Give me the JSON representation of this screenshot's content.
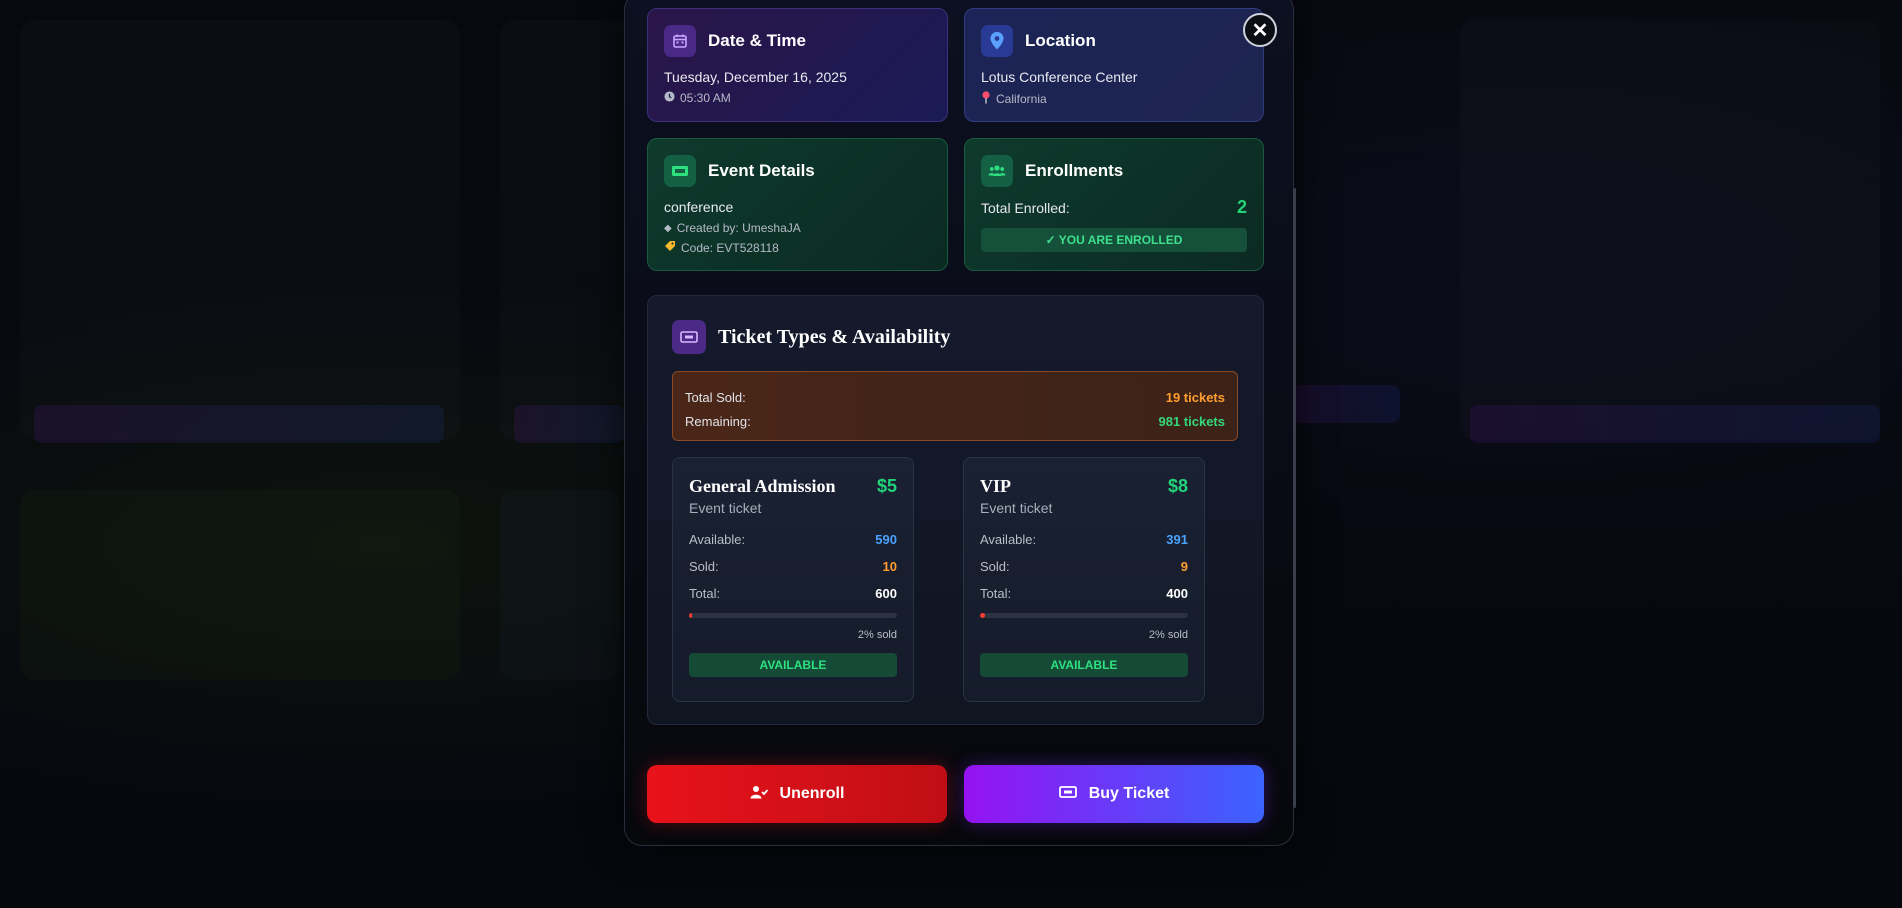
{
  "colors": {
    "accent_green": "#22d37a",
    "accent_orange": "#ff9d2e",
    "accent_blue": "#4aa3ff",
    "danger_red": "#e8121a",
    "purple": "#9512f2"
  },
  "modal": {
    "close_icon": "close-icon",
    "date_time": {
      "title": "Date & Time",
      "icon": "calendar-icon",
      "date": "Tuesday, December 16, 2025",
      "time": "05:30 AM"
    },
    "location": {
      "title": "Location",
      "icon": "map-pin-icon",
      "venue": "Lotus Conference Center",
      "region": "California"
    },
    "event_details": {
      "title": "Event Details",
      "icon": "ticket-icon",
      "category": "conference",
      "created_by": "Created by: UmeshaJA",
      "code": "Code: EVT528118"
    },
    "enrollments": {
      "title": "Enrollments",
      "icon": "users-icon",
      "label": "Total Enrolled:",
      "count": "2",
      "badge": "✓ YOU ARE ENROLLED"
    },
    "tickets": {
      "title": "Ticket Types & Availability",
      "summary": {
        "sold_label": "Total Sold:",
        "sold_value": "19 tickets",
        "remaining_label": "Remaining:",
        "remaining_value": "981 tickets"
      },
      "types": [
        {
          "name": "General Admission",
          "price": "$5",
          "description": "Event ticket",
          "available_label": "Available:",
          "available": "590",
          "sold_label": "Sold:",
          "sold": "10",
          "total_label": "Total:",
          "total": "600",
          "sold_fraction": 0.0167,
          "percent_text": "2% sold",
          "status": "AVAILABLE"
        },
        {
          "name": "VIP",
          "price": "$8",
          "description": "Event ticket",
          "available_label": "Available:",
          "available": "391",
          "sold_label": "Sold:",
          "sold": "9",
          "total_label": "Total:",
          "total": "400",
          "sold_fraction": 0.0225,
          "percent_text": "2% sold",
          "status": "AVAILABLE"
        }
      ]
    },
    "actions": {
      "unenroll_label": "Unenroll",
      "buy_label": "Buy Ticket"
    }
  }
}
